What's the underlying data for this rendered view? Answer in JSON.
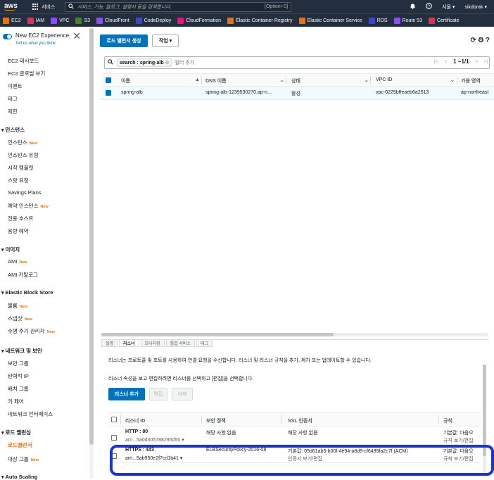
{
  "topnav": {
    "logo": "aws",
    "services_label": "서비스",
    "search_placeholder": "서비스, 기능, 블로그, 설명서 등을 검색합니다.",
    "search_shortcut": "[Option+S]",
    "region": "서울",
    "user": "sikdorak"
  },
  "favorites": [
    {
      "label": "EC2",
      "color": "#ec7211"
    },
    {
      "label": "IAM",
      "color": "#dd344c"
    },
    {
      "label": "VPC",
      "color": "#8c4fff"
    },
    {
      "label": "S3",
      "color": "#3f8624"
    },
    {
      "label": "CloudFront",
      "color": "#8c4fff"
    },
    {
      "label": "CodeDeploy",
      "color": "#3b48cc"
    },
    {
      "label": "CloudFormation",
      "color": "#e7157b"
    },
    {
      "label": "Elastic Container Registry",
      "color": "#ec7211"
    },
    {
      "label": "Elastic Container Service",
      "color": "#ec7211"
    },
    {
      "label": "RDS",
      "color": "#3b48cc"
    },
    {
      "label": "Route 53",
      "color": "#8c4fff"
    },
    {
      "label": "Certificate",
      "color": "#dd344c"
    }
  ],
  "sidebar": {
    "experience_title": "New EC2 Experience",
    "experience_sub": "Tell us what you think",
    "new_badge": "New",
    "items": {
      "dashboard": "EC2 대시보드",
      "global_view": "EC2 글로벌 보기",
      "events": "이벤트",
      "tags": "태그",
      "limits": "제한",
      "instances_section": "인스턴스",
      "instances": "인스턴스",
      "instance_types": "인스턴스 유형",
      "launch_templates": "시작 템플릿",
      "spot_requests": "스팟 요청",
      "savings_plans": "Savings Plans",
      "reserved_instances": "예약 인스턴스",
      "dedicated_hosts": "전용 호스트",
      "capacity_reservations": "용량 예약",
      "images_section": "이미지",
      "amis": "AMI",
      "ami_catalog": "AMI 카탈로그",
      "ebs_section": "Elastic Block Store",
      "volumes": "볼륨",
      "snapshots": "스냅샷",
      "lifecycle_manager": "수명 주기 관리자",
      "network_section": "네트워크 및 보안",
      "security_groups": "보안 그룹",
      "elastic_ips": "탄력적 IP",
      "placement_groups": "배치 그룹",
      "key_pairs": "키 페어",
      "network_interfaces": "네트워크 인터페이스",
      "lb_section": "로드 밸런싱",
      "load_balancers": "로드밸런서",
      "target_groups": "대상 그룹",
      "autoscaling_section": "Auto Scaling"
    }
  },
  "main": {
    "create_lb_button": "로드 밸런서 생성",
    "actions_button": "작업",
    "filter_chip": "search : spring-alb",
    "filter_placeholder": "필터 추가",
    "pager": "1 ~1/1",
    "columns": [
      "이름",
      "DNS 이름",
      "상태",
      "VPC ID",
      "가용 영역"
    ],
    "rows": [
      {
        "name": "spring-alb",
        "dns": "spring-alb-1239530270.ap-n...",
        "state": "활성",
        "vpc": "vpc-0225bffeaeb6a2513",
        "az": "ap-northeast"
      }
    ]
  },
  "detail": {
    "tabs": [
      "설명",
      "리스너",
      "모니터링",
      "통합 서비스",
      "태그"
    ],
    "desc1": "리스너는 프로토콜 및 포트를 사용하여 연결 요청을 수신합니다. 리스너 및 리스너 규칙을 추가, 제거 또는 업데이트할 수 있습니다.",
    "desc2": "리스너 속성을 보고 편집하려면 리스너를 선택하고 [편집]을 선택합니다.",
    "add_listener": "리스너 추가",
    "edit": "편집",
    "delete": "삭제",
    "columns": [
      "리스너 ID",
      "보안 정책",
      "SSL 인증서",
      "규칙"
    ],
    "listeners": [
      {
        "id": "HTTP : 80",
        "arn": "arn...5a0d305788295d50",
        "policy": "해당 사항 없음",
        "ssl": "해당 사항 없음",
        "ssl_link": "",
        "rule": "기본값: 다음으",
        "rule_link": "규칙 보기/편집"
      },
      {
        "id": "HTTPS : 443",
        "arn": "arn...5ab950e2f7cd1b41",
        "policy": "ELBSecurityPolicy-2016-08",
        "ssl": "기본값:  05d61ab5-b00f-4e94-a8d9-cf6495fa2c7f (ACM)",
        "ssl_link": "인증서 보기/편집",
        "rule": "기본값: 다음으",
        "rule_link": "규칙 보기/편집"
      }
    ]
  }
}
